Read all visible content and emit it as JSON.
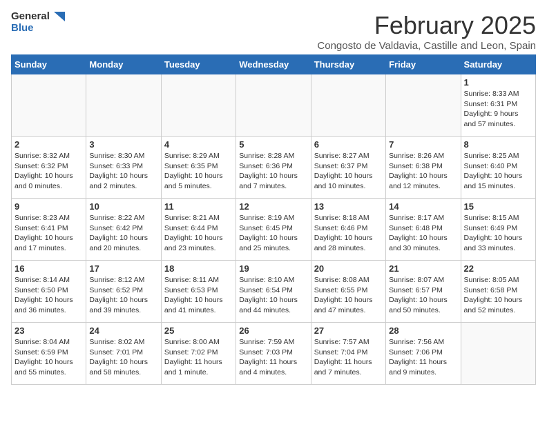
{
  "logo": {
    "line1": "General",
    "line2": "Blue"
  },
  "title": "February 2025",
  "location": "Congosto de Valdavia, Castille and Leon, Spain",
  "days_of_week": [
    "Sunday",
    "Monday",
    "Tuesday",
    "Wednesday",
    "Thursday",
    "Friday",
    "Saturday"
  ],
  "weeks": [
    [
      {
        "day": "",
        "info": ""
      },
      {
        "day": "",
        "info": ""
      },
      {
        "day": "",
        "info": ""
      },
      {
        "day": "",
        "info": ""
      },
      {
        "day": "",
        "info": ""
      },
      {
        "day": "",
        "info": ""
      },
      {
        "day": "1",
        "info": "Sunrise: 8:33 AM\nSunset: 6:31 PM\nDaylight: 9 hours\nand 57 minutes."
      }
    ],
    [
      {
        "day": "2",
        "info": "Sunrise: 8:32 AM\nSunset: 6:32 PM\nDaylight: 10 hours\nand 0 minutes."
      },
      {
        "day": "3",
        "info": "Sunrise: 8:30 AM\nSunset: 6:33 PM\nDaylight: 10 hours\nand 2 minutes."
      },
      {
        "day": "4",
        "info": "Sunrise: 8:29 AM\nSunset: 6:35 PM\nDaylight: 10 hours\nand 5 minutes."
      },
      {
        "day": "5",
        "info": "Sunrise: 8:28 AM\nSunset: 6:36 PM\nDaylight: 10 hours\nand 7 minutes."
      },
      {
        "day": "6",
        "info": "Sunrise: 8:27 AM\nSunset: 6:37 PM\nDaylight: 10 hours\nand 10 minutes."
      },
      {
        "day": "7",
        "info": "Sunrise: 8:26 AM\nSunset: 6:38 PM\nDaylight: 10 hours\nand 12 minutes."
      },
      {
        "day": "8",
        "info": "Sunrise: 8:25 AM\nSunset: 6:40 PM\nDaylight: 10 hours\nand 15 minutes."
      }
    ],
    [
      {
        "day": "9",
        "info": "Sunrise: 8:23 AM\nSunset: 6:41 PM\nDaylight: 10 hours\nand 17 minutes."
      },
      {
        "day": "10",
        "info": "Sunrise: 8:22 AM\nSunset: 6:42 PM\nDaylight: 10 hours\nand 20 minutes."
      },
      {
        "day": "11",
        "info": "Sunrise: 8:21 AM\nSunset: 6:44 PM\nDaylight: 10 hours\nand 23 minutes."
      },
      {
        "day": "12",
        "info": "Sunrise: 8:19 AM\nSunset: 6:45 PM\nDaylight: 10 hours\nand 25 minutes."
      },
      {
        "day": "13",
        "info": "Sunrise: 8:18 AM\nSunset: 6:46 PM\nDaylight: 10 hours\nand 28 minutes."
      },
      {
        "day": "14",
        "info": "Sunrise: 8:17 AM\nSunset: 6:48 PM\nDaylight: 10 hours\nand 30 minutes."
      },
      {
        "day": "15",
        "info": "Sunrise: 8:15 AM\nSunset: 6:49 PM\nDaylight: 10 hours\nand 33 minutes."
      }
    ],
    [
      {
        "day": "16",
        "info": "Sunrise: 8:14 AM\nSunset: 6:50 PM\nDaylight: 10 hours\nand 36 minutes."
      },
      {
        "day": "17",
        "info": "Sunrise: 8:12 AM\nSunset: 6:52 PM\nDaylight: 10 hours\nand 39 minutes."
      },
      {
        "day": "18",
        "info": "Sunrise: 8:11 AM\nSunset: 6:53 PM\nDaylight: 10 hours\nand 41 minutes."
      },
      {
        "day": "19",
        "info": "Sunrise: 8:10 AM\nSunset: 6:54 PM\nDaylight: 10 hours\nand 44 minutes."
      },
      {
        "day": "20",
        "info": "Sunrise: 8:08 AM\nSunset: 6:55 PM\nDaylight: 10 hours\nand 47 minutes."
      },
      {
        "day": "21",
        "info": "Sunrise: 8:07 AM\nSunset: 6:57 PM\nDaylight: 10 hours\nand 50 minutes."
      },
      {
        "day": "22",
        "info": "Sunrise: 8:05 AM\nSunset: 6:58 PM\nDaylight: 10 hours\nand 52 minutes."
      }
    ],
    [
      {
        "day": "23",
        "info": "Sunrise: 8:04 AM\nSunset: 6:59 PM\nDaylight: 10 hours\nand 55 minutes."
      },
      {
        "day": "24",
        "info": "Sunrise: 8:02 AM\nSunset: 7:01 PM\nDaylight: 10 hours\nand 58 minutes."
      },
      {
        "day": "25",
        "info": "Sunrise: 8:00 AM\nSunset: 7:02 PM\nDaylight: 11 hours\nand 1 minute."
      },
      {
        "day": "26",
        "info": "Sunrise: 7:59 AM\nSunset: 7:03 PM\nDaylight: 11 hours\nand 4 minutes."
      },
      {
        "day": "27",
        "info": "Sunrise: 7:57 AM\nSunset: 7:04 PM\nDaylight: 11 hours\nand 7 minutes."
      },
      {
        "day": "28",
        "info": "Sunrise: 7:56 AM\nSunset: 7:06 PM\nDaylight: 11 hours\nand 9 minutes."
      },
      {
        "day": "",
        "info": ""
      }
    ]
  ]
}
